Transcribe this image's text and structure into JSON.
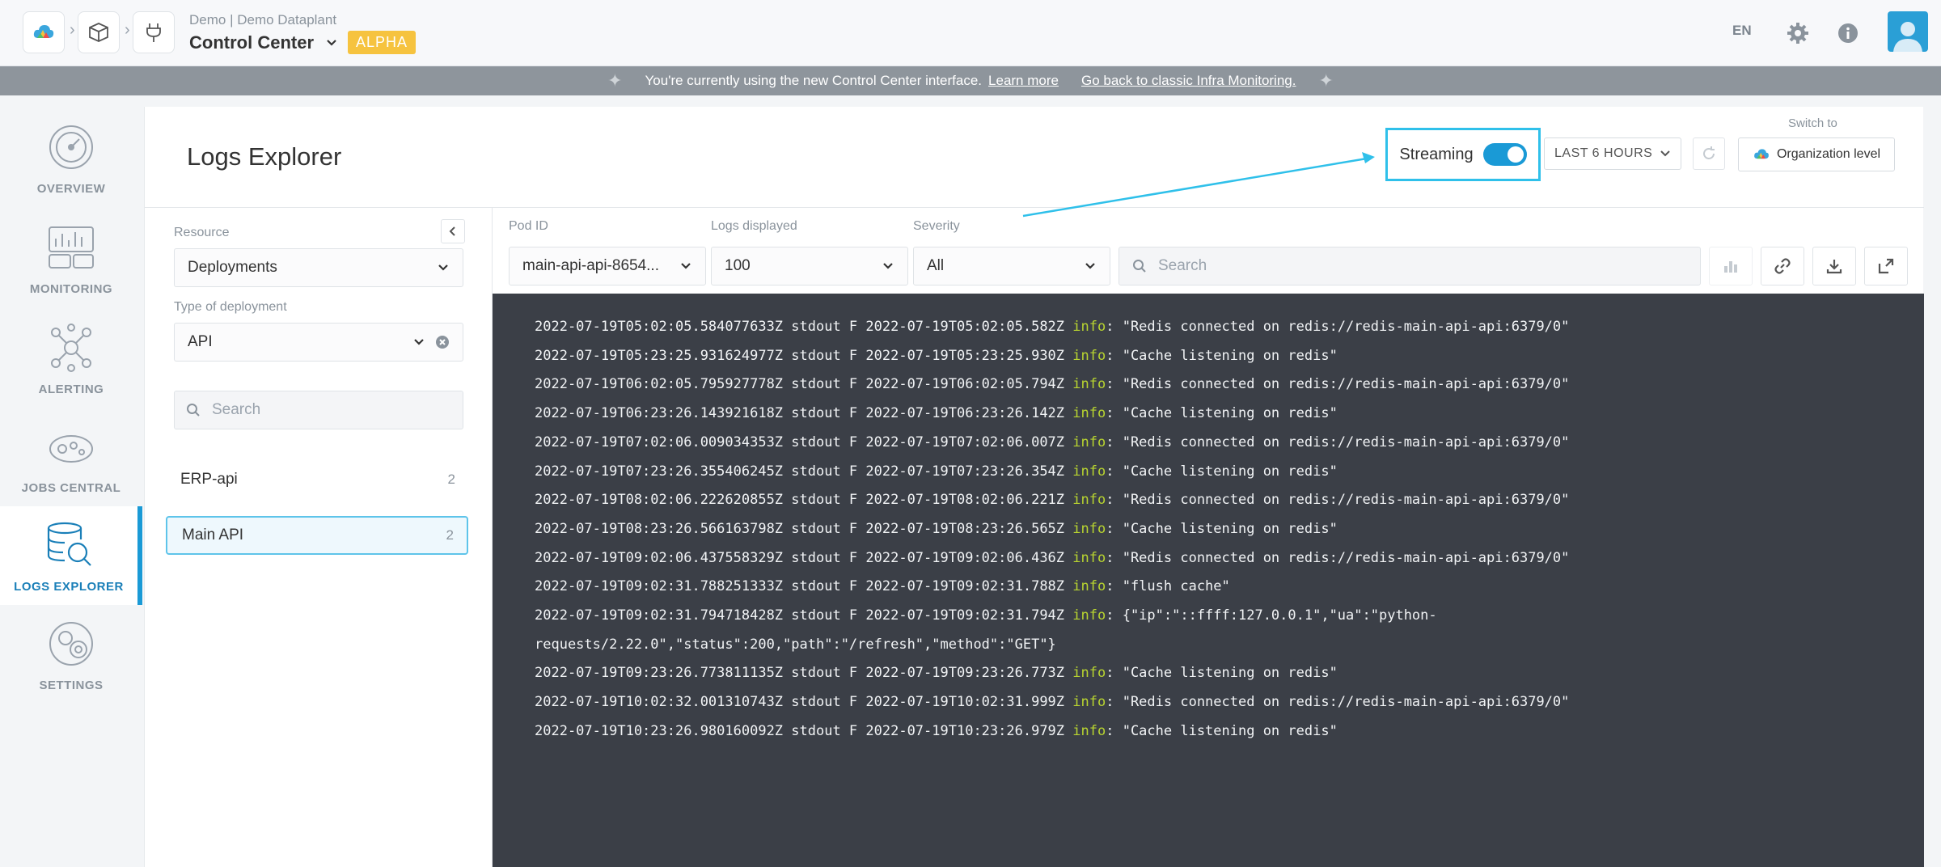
{
  "header": {
    "org_sub": "Demo | Demo Dataplant",
    "org_title": "Control Center",
    "badge": "ALPHA",
    "language": "EN",
    "icons": [
      "cloud-logo-icon",
      "cube-icon",
      "plug-icon",
      "gear-icon",
      "info-icon",
      "user-avatar-icon"
    ]
  },
  "banner": {
    "text": "You're currently using the new Control Center interface.",
    "learn_more": "Learn more",
    "classic_link": "Go back to classic Infra Monitoring."
  },
  "nav": {
    "items": [
      {
        "label": "OVERVIEW",
        "icon": "gauge-icon"
      },
      {
        "label": "MONITORING",
        "icon": "chart-icon"
      },
      {
        "label": "ALERTING",
        "icon": "alert-network-icon"
      },
      {
        "label": "JOBS CENTRAL",
        "icon": "jobs-icon"
      },
      {
        "label": "LOGS EXPLORER",
        "icon": "database-search-icon",
        "active": true
      },
      {
        "label": "SETTINGS",
        "icon": "settings-icon"
      }
    ]
  },
  "page": {
    "title": "Logs Explorer",
    "streaming_label": "Streaming",
    "streaming_on": true,
    "time_range": "LAST 6 HOURS",
    "switch_to_label": "Switch to",
    "org_level_button": "Organization level"
  },
  "side_panel": {
    "resource_label": "Resource",
    "resource_value": "Deployments",
    "type_label": "Type of deployment",
    "type_value": "API",
    "search_placeholder": "Search",
    "items": [
      {
        "name": "ERP-api",
        "count": "2"
      },
      {
        "name": "Main API",
        "count": "2",
        "selected": true
      }
    ]
  },
  "filters": {
    "pod_label": "Pod ID",
    "pod_value": "main-api-api-8654...",
    "logs_label": "Logs displayed",
    "logs_value": "100",
    "severity_label": "Severity",
    "severity_value": "All",
    "search_placeholder": "Search"
  },
  "colors": {
    "accent": "#1a9ad6",
    "highlight": "#2fc0ea",
    "console_bg": "#3b3f47",
    "info_level": "#b8d430",
    "alpha_badge": "#f6c33f"
  },
  "logs": [
    {
      "prefix": "2022-07-19T05:02:05.584077633Z stdout F 2022-07-19T05:02:05.582Z ",
      "level": "info",
      "msg": ": \"Redis connected on redis://redis-main-api-api:6379/0\""
    },
    {
      "prefix": "2022-07-19T05:23:25.931624977Z stdout F 2022-07-19T05:23:25.930Z ",
      "level": "info",
      "msg": ": \"Cache listening on redis\""
    },
    {
      "prefix": "2022-07-19T06:02:05.795927778Z stdout F 2022-07-19T06:02:05.794Z ",
      "level": "info",
      "msg": ": \"Redis connected on redis://redis-main-api-api:6379/0\""
    },
    {
      "prefix": "2022-07-19T06:23:26.143921618Z stdout F 2022-07-19T06:23:26.142Z ",
      "level": "info",
      "msg": ": \"Cache listening on redis\""
    },
    {
      "prefix": "2022-07-19T07:02:06.009034353Z stdout F 2022-07-19T07:02:06.007Z ",
      "level": "info",
      "msg": ": \"Redis connected on redis://redis-main-api-api:6379/0\""
    },
    {
      "prefix": "2022-07-19T07:23:26.355406245Z stdout F 2022-07-19T07:23:26.354Z ",
      "level": "info",
      "msg": ": \"Cache listening on redis\""
    },
    {
      "prefix": "2022-07-19T08:02:06.222620855Z stdout F 2022-07-19T08:02:06.221Z ",
      "level": "info",
      "msg": ": \"Redis connected on redis://redis-main-api-api:6379/0\""
    },
    {
      "prefix": "2022-07-19T08:23:26.566163798Z stdout F 2022-07-19T08:23:26.565Z ",
      "level": "info",
      "msg": ": \"Cache listening on redis\""
    },
    {
      "prefix": "2022-07-19T09:02:06.437558329Z stdout F 2022-07-19T09:02:06.436Z ",
      "level": "info",
      "msg": ": \"Redis connected on redis://redis-main-api-api:6379/0\""
    },
    {
      "prefix": "2022-07-19T09:02:31.788251333Z stdout F 2022-07-19T09:02:31.788Z ",
      "level": "info",
      "msg": ": \"flush cache\""
    },
    {
      "prefix": "2022-07-19T09:02:31.794718428Z stdout F 2022-07-19T09:02:31.794Z ",
      "level": "info",
      "msg": ": {\"ip\":\"::ffff:127.0.0.1\",\"ua\":\"python-"
    },
    {
      "prefix": "requests/2.22.0\",\"status\":200,\"path\":\"/refresh\",\"method\":\"GET\"}",
      "level": "",
      "msg": ""
    },
    {
      "prefix": "2022-07-19T09:23:26.773811135Z stdout F 2022-07-19T09:23:26.773Z ",
      "level": "info",
      "msg": ": \"Cache listening on redis\""
    },
    {
      "prefix": "2022-07-19T10:02:32.001310743Z stdout F 2022-07-19T10:02:31.999Z ",
      "level": "info",
      "msg": ": \"Redis connected on redis://redis-main-api-api:6379/0\""
    },
    {
      "prefix": "2022-07-19T10:23:26.980160092Z stdout F 2022-07-19T10:23:26.979Z ",
      "level": "info",
      "msg": ": \"Cache listening on redis\""
    }
  ]
}
